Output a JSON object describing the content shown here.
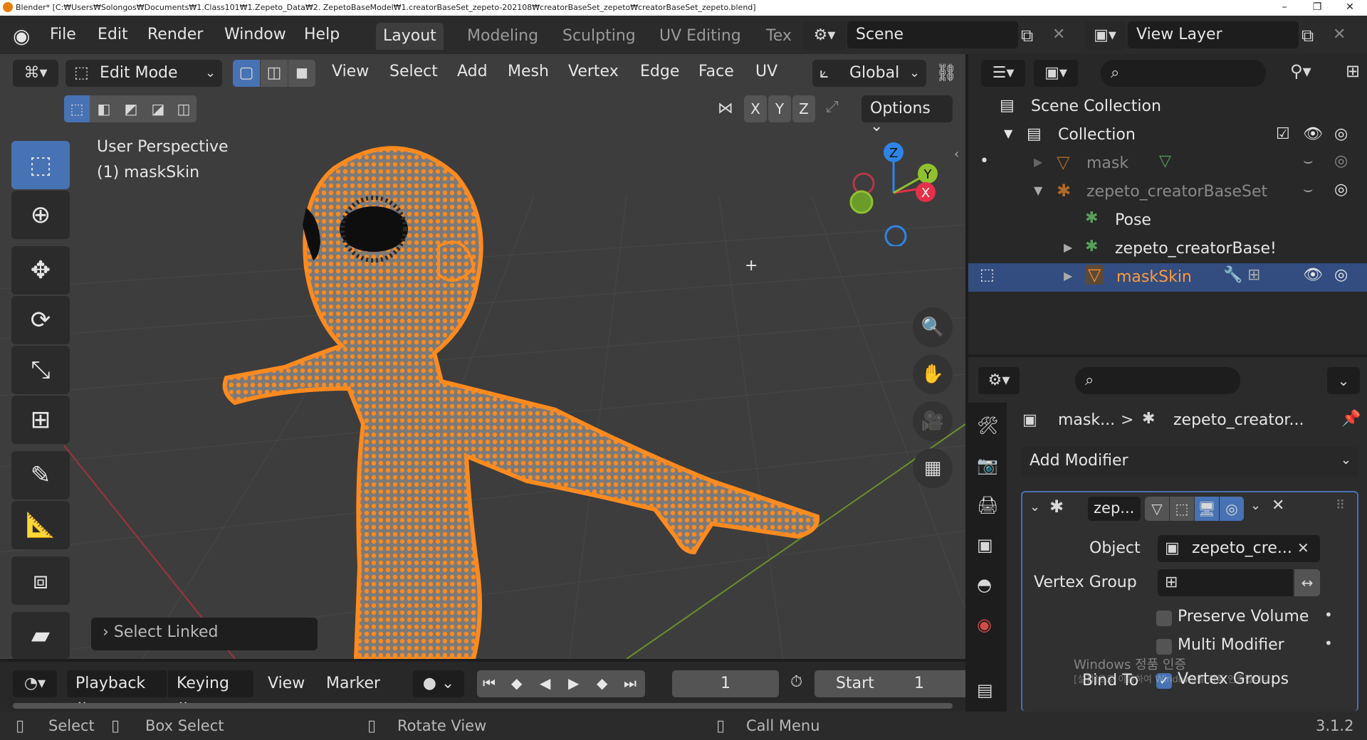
{
  "titlebar": {
    "title": "Blender* [C:₩Users₩Solongos₩Documents₩1.Class101₩1.Zepeto_Data₩2. ZepetoBaseModel₩1.creatorBaseSet_zepeto-202108₩creatorBaseSet_zepeto₩creatorBaseSet_zepeto.blend]",
    "minimize": "–",
    "maximize": "❐",
    "close": "✕"
  },
  "menu": {
    "file": "File",
    "edit": "Edit",
    "render": "Render",
    "window": "Window",
    "help": "Help"
  },
  "workspaces": [
    {
      "label": "Layout"
    },
    {
      "label": "Modeling"
    },
    {
      "label": "Sculpting"
    },
    {
      "label": "UV Editing"
    },
    {
      "label": "Tex"
    }
  ],
  "scene": {
    "name": "Scene",
    "view_layer": "View Layer"
  },
  "viewport": {
    "mode": "Edit Mode",
    "menus": {
      "view": "View",
      "select": "Select",
      "add": "Add",
      "mesh": "Mesh",
      "vertex": "Vertex",
      "edge": "Edge",
      "face": "Face",
      "uv": "UV"
    },
    "transform_orientation": "Global",
    "axes": {
      "x": "X",
      "y": "Y",
      "z": "Z"
    },
    "options": "Options",
    "perspective": "User Perspective",
    "object_info": "(1) maskSkin",
    "last_op": "Select Linked",
    "gizmo": {
      "x": "X",
      "y": "Y",
      "z": "Z"
    }
  },
  "outliner": {
    "scene_collection": "Scene Collection",
    "collection": "Collection",
    "items": [
      {
        "label": "mask"
      },
      {
        "label": "zepeto_creatorBaseSet"
      },
      {
        "label": "Pose"
      },
      {
        "label": "zepeto_creatorBase!"
      },
      {
        "label": "maskSkin"
      }
    ]
  },
  "properties": {
    "breadcrumb_obj": "mask...",
    "breadcrumb_sep": ">",
    "breadcrumb_arm": "zepeto_creator...",
    "add_modifier": "Add Modifier",
    "modifier_name": "zep...",
    "object_label": "Object",
    "object_value": "zepeto_cre...",
    "vertex_group_label": "Vertex Group",
    "preserve_volume": "Preserve Volume",
    "multi_modifier": "Multi Modifier",
    "bind_to": "Bind To",
    "vertex_groups": "Vertex Groups",
    "watermark_1": "Windows 정품 인증",
    "watermark_2": "[설정]으로 이동하여 Windows를 정품 인증합니다."
  },
  "timeline": {
    "playback": "Playback",
    "keying": "Keying",
    "view": "View",
    "marker": "Marker",
    "current_frame": "1",
    "start_label": "Start",
    "start_value": "1"
  },
  "statusbar": {
    "select": "Select",
    "box_select": "Box Select",
    "rotate_view": "Rotate View",
    "call_menu": "Call Menu",
    "version": "3.1.2"
  },
  "colors": {
    "accent": "#4772b3",
    "mesh": "#ff8a1f",
    "x_axis": "#e5304a",
    "y_axis": "#8fc130",
    "z_axis": "#2e85e6"
  }
}
